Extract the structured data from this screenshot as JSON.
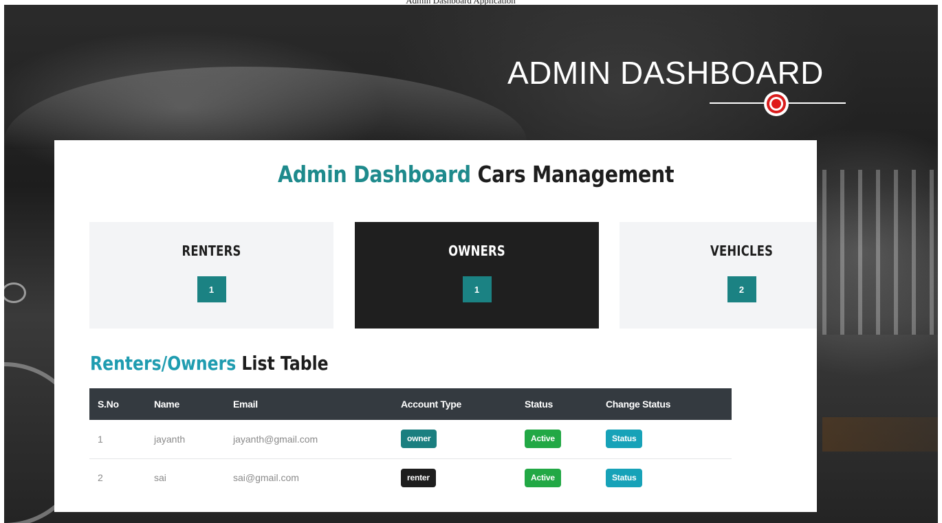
{
  "caption": "Admin Dashboard Application",
  "hero": {
    "title": "ADMIN DASHBOARD",
    "accent_color": "#d91c1c"
  },
  "panel": {
    "title_highlight": "Admin Dashboard",
    "title_rest": "Cars Management"
  },
  "cards": [
    {
      "label": "RENTERS",
      "count": "1",
      "active": false
    },
    {
      "label": "OWNERS",
      "count": "1",
      "active": true
    },
    {
      "label": "VEHICLES",
      "count": "2",
      "active": false
    }
  ],
  "table_section": {
    "title_highlight": "Renters/Owners",
    "title_rest": "List Table",
    "columns": [
      "S.No",
      "Name",
      "Email",
      "Account Type",
      "Status",
      "Change Status"
    ],
    "rows": [
      {
        "sno": "1",
        "name": "jayanth",
        "email": "jayanth@gmail.com",
        "account_type": "owner",
        "status": "Active",
        "action": "Status"
      },
      {
        "sno": "2",
        "name": "sai",
        "email": "sai@gmail.com",
        "account_type": "renter",
        "status": "Active",
        "action": "Status"
      }
    ]
  },
  "colors": {
    "teal": "#1e8a8c",
    "section_blue": "#1f9cb0",
    "table_header": "#343a40",
    "active_green": "#22a845",
    "status_cyan": "#17a2b8"
  }
}
